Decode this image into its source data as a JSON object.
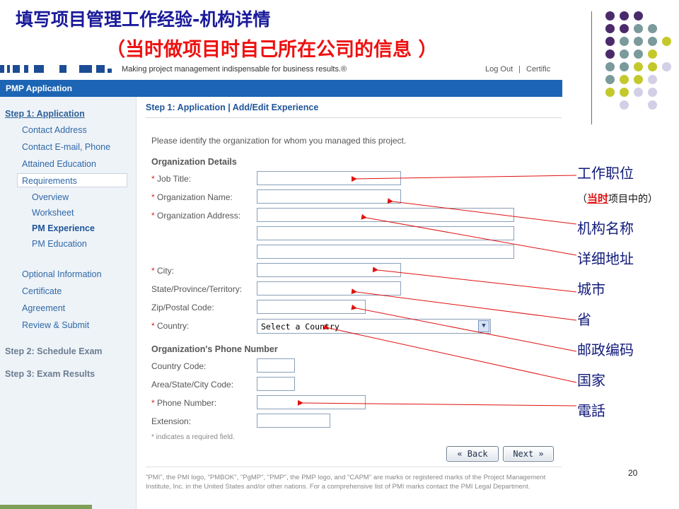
{
  "slide": {
    "title": "填写项目管理工作经验-机构详情",
    "subtitle": "（当时做项目时自己所在公司的信息 ）",
    "page_number": "20"
  },
  "header": {
    "tagline": "Making project management indispensable for business results.®",
    "logout": "Log Out",
    "separator": "|",
    "certific": "Certific"
  },
  "app_bar": {
    "title": "PMP Application"
  },
  "sidebar": {
    "step1": "Step 1: Application",
    "contact_address": "Contact Address",
    "contact_email": "Contact E-mail, Phone",
    "attained_education": "Attained Education",
    "requirements": "Requirements",
    "overview": "Overview",
    "worksheet": "Worksheet",
    "pm_experience": "PM Experience",
    "pm_education": "PM Education",
    "optional_information": "Optional Information",
    "certificate": "Certificate",
    "agreement": "Agreement",
    "review_submit": "Review & Submit",
    "step2": "Step 2: Schedule Exam",
    "step3": "Step 3: Exam Results"
  },
  "main": {
    "heading": "Step 1: Application | Add/Edit Experience",
    "intro": "Please identify the organization for whom you managed this project.",
    "org_details": "Organization Details",
    "job_title": "Job Title:",
    "org_name": "Organization Name:",
    "org_address": "Organization Address:",
    "city": "City:",
    "state": "State/Province/Territory:",
    "zip": "Zip/Postal Code:",
    "country": "Country:",
    "country_select": "Select a Country",
    "phone_section": "Organization's Phone Number",
    "country_code": "Country Code:",
    "area_code": "Area/State/City Code:",
    "phone_number": "Phone Number:",
    "extension": "Extension:",
    "required_star": "*",
    "required_note": "* indicates a required field.",
    "back_button": "« Back",
    "next_button": "Next »",
    "footer": "\"PMI\", the PMI logo, \"PMBOK\", \"PgMP\", \"PMP\", the PMP logo, and \"CAPM\" are marks or registered marks of the Project Management Institute, Inc. in the United States and/or other nations. For a comprehensive list of PMI marks contact the PMI Legal Department."
  },
  "annotations": {
    "job_title": "工作职位",
    "sub_open": "（",
    "sub_highlight": "当时",
    "sub_rest": "项目中的）",
    "org_name": "机构名称",
    "address": "详细地址",
    "city": "城市",
    "province": "省",
    "zip": "邮政编码",
    "country": "国家",
    "phone": "電話"
  },
  "colors": {
    "title_blue": "#1a1a9a",
    "subtitle_red": "#ee1111",
    "app_bar_blue": "#1c64b4",
    "arrow_red": "#e01010",
    "dot_purple": "#4b2a6b",
    "dot_teal": "#7a9a9c",
    "dot_yellow": "#c3c92a",
    "dot_lavender": "#d2cfe6"
  }
}
